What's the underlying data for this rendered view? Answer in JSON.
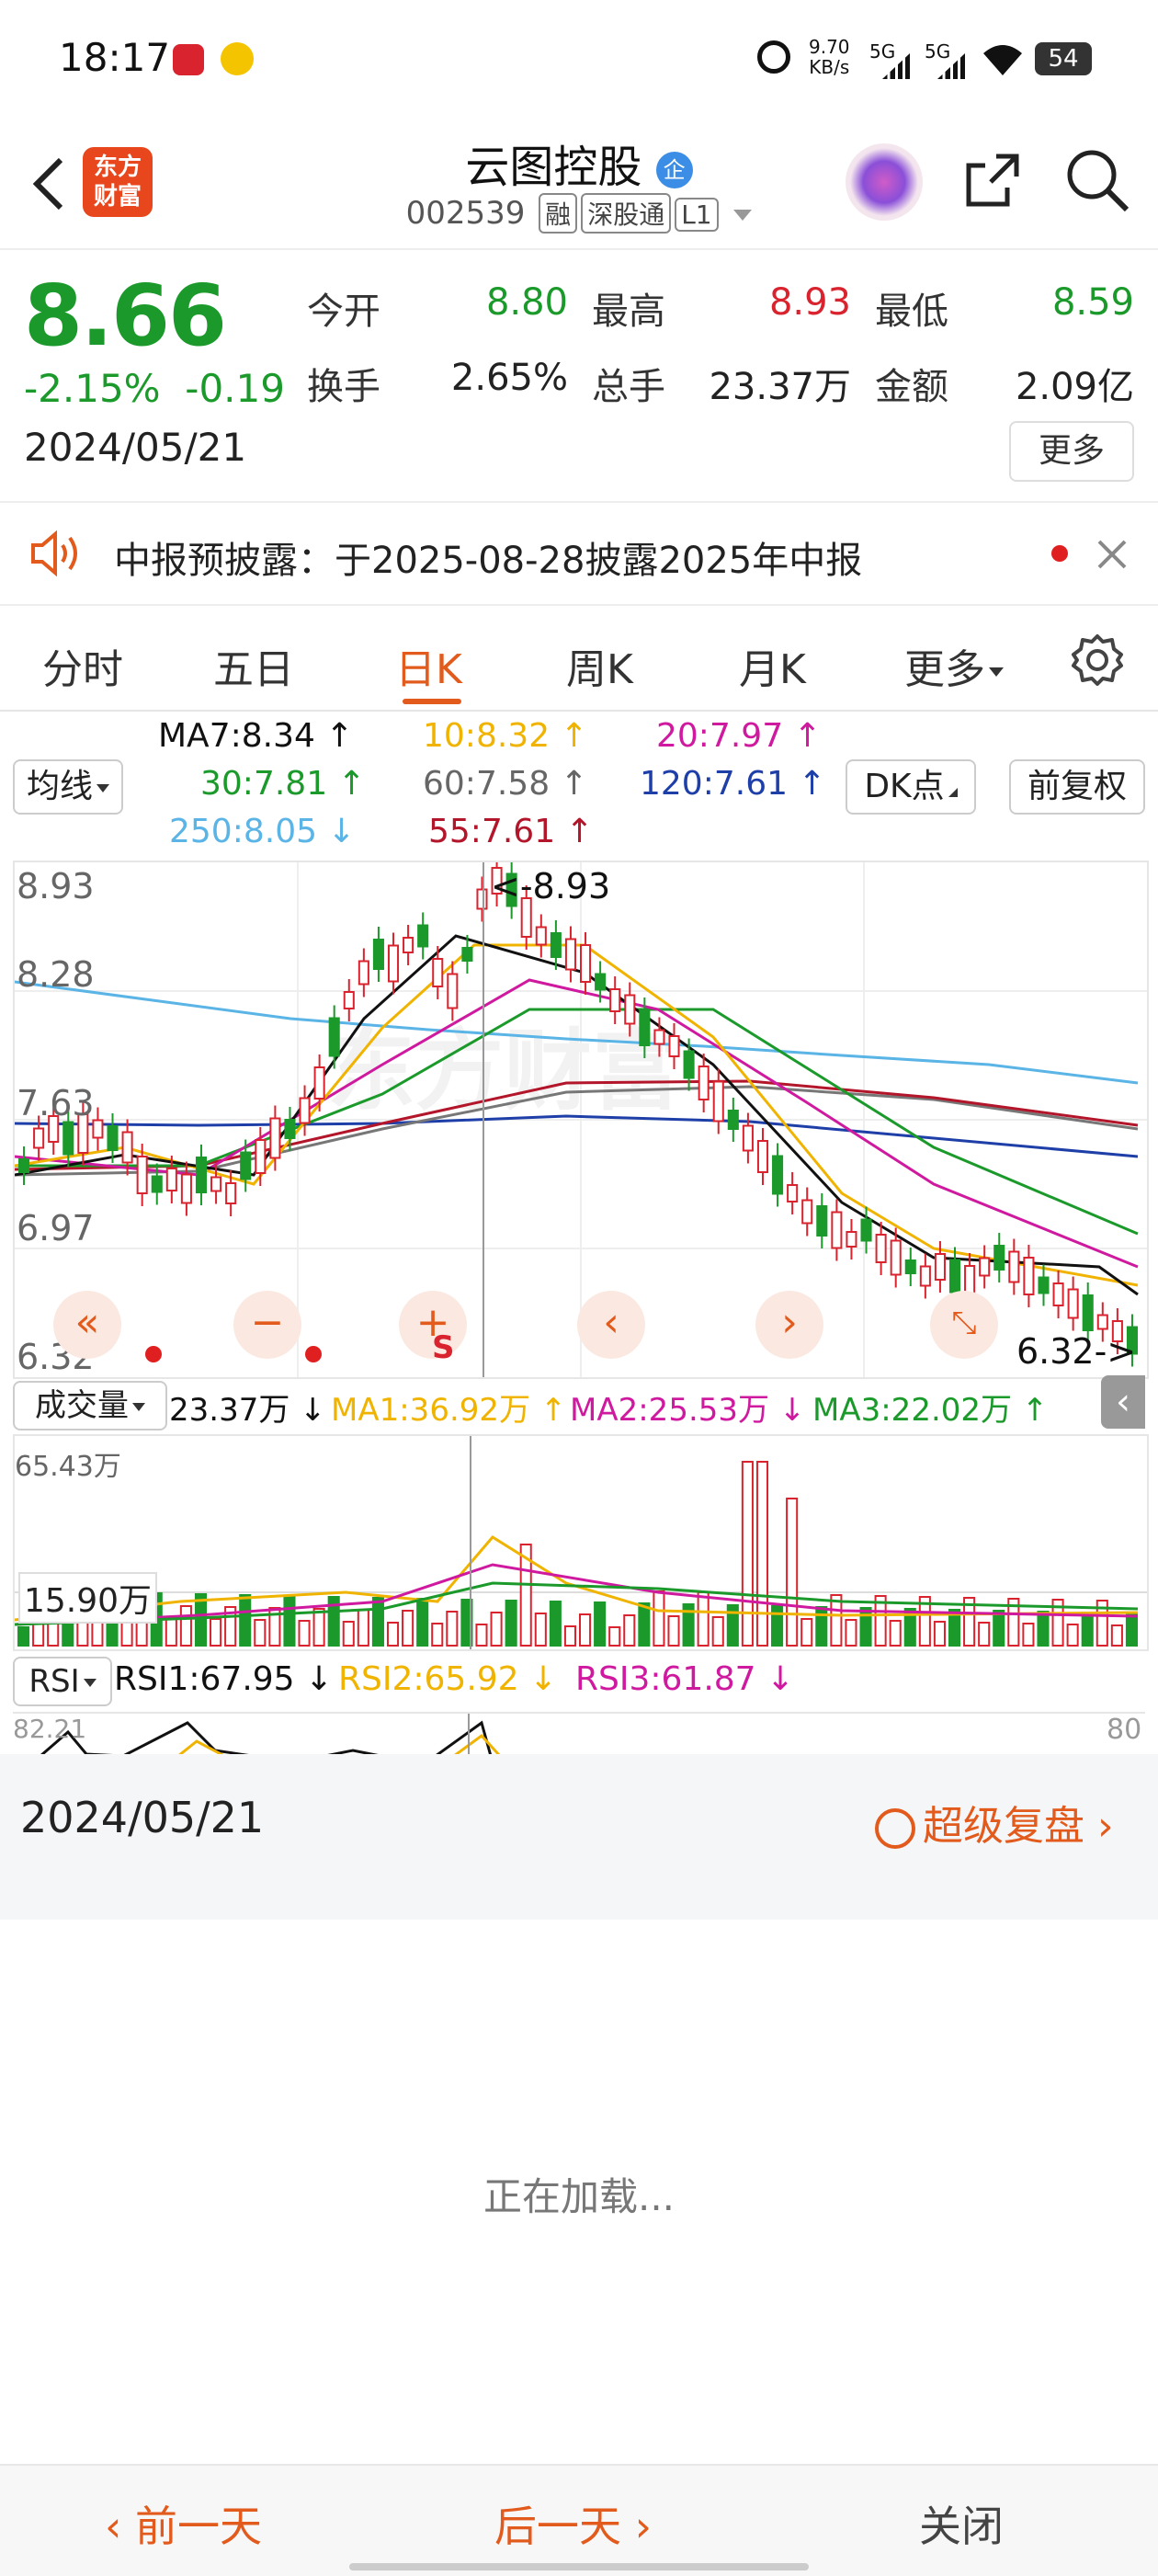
{
  "status": {
    "time": "18:17",
    "net_speed_value": "9.70",
    "net_speed_unit": "KB/s",
    "sig1": "5G",
    "sig2": "5G",
    "battery": "54"
  },
  "header": {
    "logo_line1": "东方",
    "logo_line2": "财富",
    "title": "云图控股",
    "title_badge": "企",
    "code": "002539",
    "tag1": "融",
    "tag2": "深股通",
    "tag3": "L1"
  },
  "quote": {
    "price": "8.66",
    "change_pct": "-2.15%",
    "change": "-0.19",
    "date": "2024/05/21",
    "open_label": "今开",
    "open": "8.80",
    "high_label": "最高",
    "high": "8.93",
    "low_label": "最低",
    "low": "8.59",
    "turnover_label": "换手",
    "turnover": "2.65%",
    "volume_label": "总手",
    "volume": "23.37万",
    "amount_label": "金额",
    "amount": "2.09亿",
    "more": "更多"
  },
  "notice": {
    "text": "中报预披露：于2025-08-28披露2025年中报"
  },
  "tabs": [
    "分时",
    "五日",
    "日K",
    "周K",
    "月K",
    "更多"
  ],
  "active_tab": "日K",
  "ma": {
    "line_btn": "均线",
    "ma7": "MA7:8.34 ↑",
    "ma10": "10:8.32 ↑",
    "ma20": "20:7.97 ↑",
    "ma30": "30:7.81 ↑",
    "ma60": "60:7.58 ↑",
    "ma120": "120:7.61 ↑",
    "ma250": "250:8.05 ↓",
    "ma55": "55:7.61 ↑",
    "dk": "DK点",
    "fq": "前复权"
  },
  "chart": {
    "ylabels": [
      "8.93",
      "8.28",
      "7.63",
      "6.97",
      "6.32"
    ],
    "high_label": "<-8.93",
    "low_label": "6.32->",
    "ctl_s": "S"
  },
  "volume_bar": {
    "sel": "成交量",
    "value": "23.37万 ↓",
    "ma1": "MA1:36.92万 ↑",
    "ma2": "MA2:25.53万 ↓",
    "ma3": "MA3:22.02万 ↑",
    "ymax": "65.43万",
    "ymid": "15.90万"
  },
  "rsi": {
    "sel": "RSI",
    "rsi1": "RSI1:67.95 ↓",
    "rsi2": "RSI2:65.92 ↓",
    "rsi3": "RSI3:61.87 ↓",
    "ytop": "82.21",
    "yright": "80"
  },
  "replay": {
    "date": "2024/05/21",
    "link": "超级复盘"
  },
  "loading": "正在加载...",
  "footer": {
    "prev": "前一天",
    "next": "后一天",
    "close": "关闭"
  },
  "colors": {
    "up": "#d9232e",
    "down": "#1b9a2b",
    "accent": "#e25a1c"
  }
}
